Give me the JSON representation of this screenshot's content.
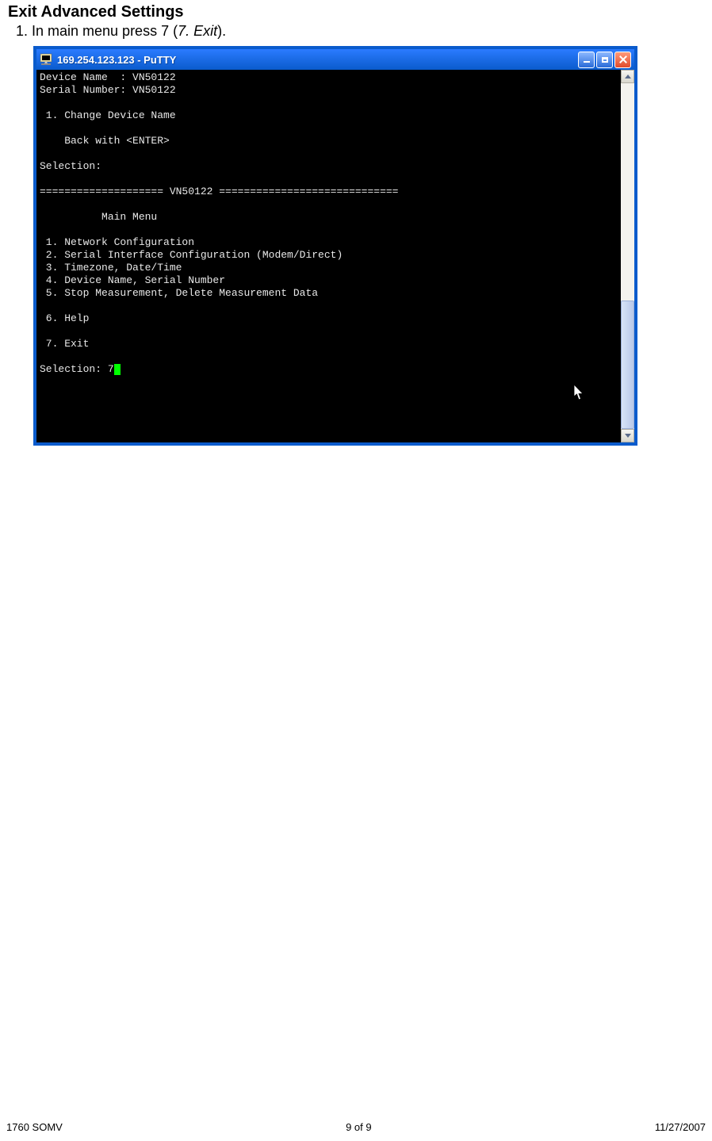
{
  "document": {
    "heading": "Exit Advanced Settings",
    "step_number": "1.",
    "step_text_pre": "In main menu press 7 (",
    "step_text_italic": "7. Exit",
    "step_text_post": ")."
  },
  "putty": {
    "title": "169.254.123.123 - PuTTY",
    "terminal_lines": [
      "Device Name  : VN50122",
      "Serial Number: VN50122",
      "",
      " 1. Change Device Name",
      "",
      "    Back with <ENTER>",
      "",
      "Selection:",
      "",
      "==================== VN50122 =============================",
      "",
      "          Main Menu",
      "",
      " 1. Network Configuration",
      " 2. Serial Interface Configuration (Modem/Direct)",
      " 3. Timezone, Date/Time",
      " 4. Device Name, Serial Number",
      " 5. Stop Measurement, Delete Measurement Data",
      "",
      " 6. Help",
      "",
      " 7. Exit",
      ""
    ],
    "selection_prompt": "Selection: ",
    "selection_value": "7"
  },
  "footer": {
    "left": "1760 SOMV",
    "center": "9 of 9",
    "right": "11/27/2007"
  }
}
